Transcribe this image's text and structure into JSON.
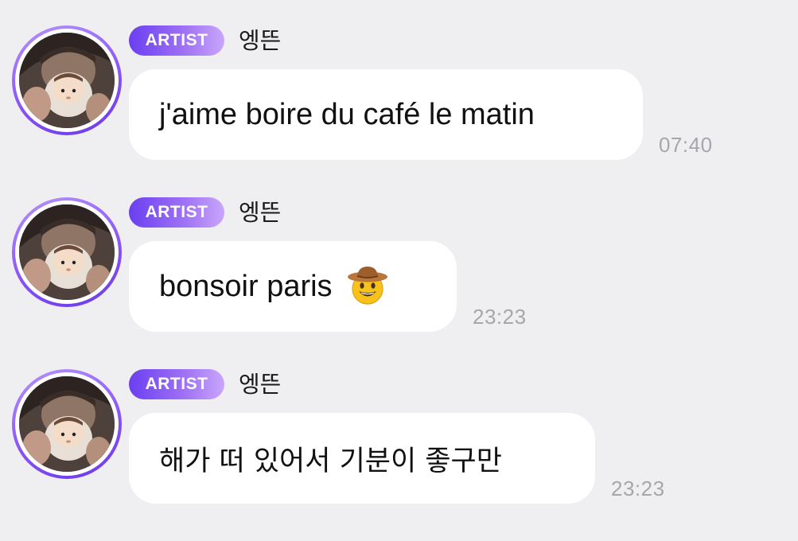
{
  "messages": [
    {
      "badge": "ARTIST",
      "sender": "엥뜬",
      "text": "j'aime boire du café le matin",
      "emoji": "",
      "time": "07:40"
    },
    {
      "badge": "ARTIST",
      "sender": "엥뜬",
      "text": "bonsoir paris",
      "emoji": "cowboy-hat-face-icon",
      "time": "23:23"
    },
    {
      "badge": "ARTIST",
      "sender": "엥뜬",
      "text": "해가 떠 있어서 기분이 좋구만",
      "emoji": "",
      "time": "23:23"
    }
  ],
  "colors": {
    "background": "#efeff1",
    "bubble": "#ffffff",
    "badge_start": "#6a3ff0",
    "badge_end": "#c9a6fb",
    "avatar_ring": "#8a55f5",
    "timestamp": "#a6a6ab"
  }
}
